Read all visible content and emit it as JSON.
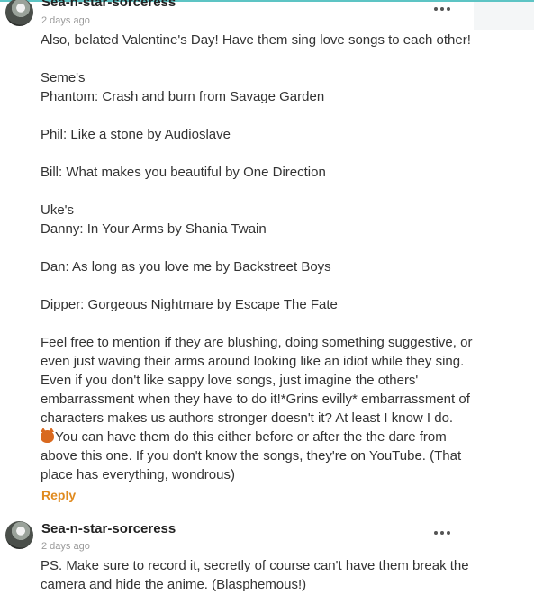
{
  "comments": [
    {
      "username": "Sea-n-star-sorceress",
      "timestamp": "2 days ago",
      "paragraphs": [
        "Also, belated Valentine's Day! Have them sing love songs to each other!",
        "",
        "Seme's",
        "Phantom: Crash and burn from Savage Garden",
        "",
        "Phil: Like a stone by Audioslave",
        "",
        "Bill: What makes you beautiful by One Direction",
        "",
        "Uke's",
        "Danny: In Your Arms by Shania Twain",
        "",
        "Dan: As long as you love me by Backstreet Boys",
        "",
        "Dipper: Gorgeous Nightmare by Escape The Fate",
        "",
        "Feel free to mention if they are blushing, doing something suggestive, or even just waving their arms around looking like an idiot while they sing. Even if you don't like sappy love songs, just imagine the others' embarrassment when they have to do it!*Grins evilly* embarrassment of characters makes us authors stronger doesn't it? At least I know I do."
      ],
      "emoji_line": "You can have them do this either before or after the the dare from above this one. If you don't know the songs, they're on YouTube. (That place has everything, wondrous)",
      "emoji_icon": "devil-emoji",
      "reply_label": "Reply"
    },
    {
      "username": "Sea-n-star-sorceress",
      "timestamp": "2 days ago",
      "paragraphs": [
        "PS. Make sure to record it, secretly of course can't have them break the camera and hide the anime. (Blasphemous!)"
      ]
    }
  ],
  "colors": {
    "accent": "#5dc4c4",
    "reply": "#e08a1e",
    "timestamp": "#9a9a9a"
  }
}
